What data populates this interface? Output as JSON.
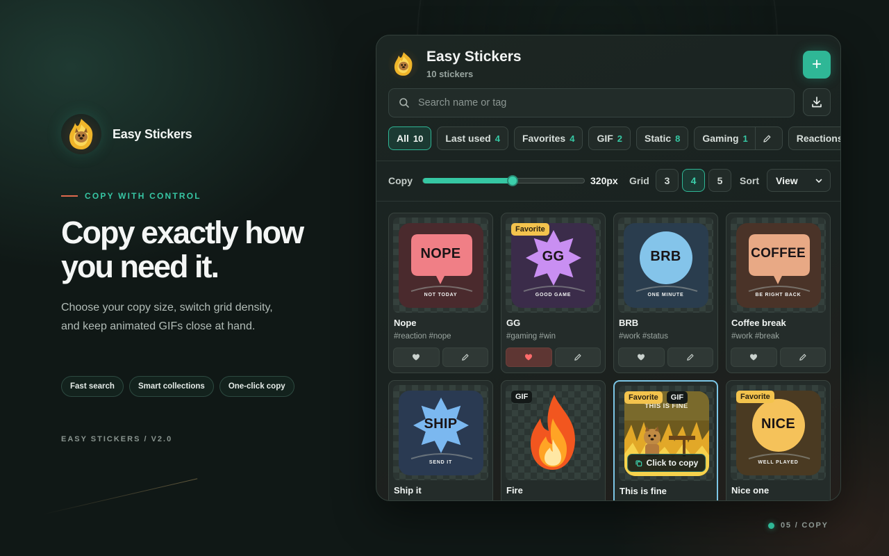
{
  "brand": {
    "name": "Easy Stickers"
  },
  "hero": {
    "eyebrow": "COPY WITH CONTROL",
    "title_line1": "Copy exactly how",
    "title_line2": "you need it.",
    "description": "Choose your copy size, switch grid density, and keep animated GIFs close at hand.",
    "pills": [
      "Fast search",
      "Smart collections",
      "One-click copy"
    ],
    "version": "EASY STICKERS / V2.0"
  },
  "app": {
    "title": "Easy Stickers",
    "count": "10 stickers",
    "search_placeholder": "Search name or tag",
    "filters": [
      {
        "label": "All",
        "count": "10"
      },
      {
        "label": "Last used",
        "count": "4"
      },
      {
        "label": "Favorites",
        "count": "4"
      },
      {
        "label": "GIF",
        "count": "2"
      },
      {
        "label": "Static",
        "count": "8"
      },
      {
        "label": "Gaming",
        "count": "1"
      },
      {
        "label": "Reactions"
      }
    ],
    "controls": {
      "copy_label": "Copy",
      "copy_value": "320px",
      "copy_fraction": 0.55,
      "grid_label": "Grid",
      "grid_options": [
        "3",
        "4",
        "5"
      ],
      "grid_selected": "4",
      "sort_label": "Sort",
      "sort_value": "View"
    },
    "stickers": [
      {
        "name": "Nope",
        "tags": "#reaction #nope",
        "text": "NOPE",
        "sub": "NOT TODAY",
        "color": "#f07f86",
        "bg": "#4a2a2d",
        "shape": "bubble",
        "favorite": false
      },
      {
        "name": "GG",
        "tags": "#gaming #win",
        "text": "GG",
        "sub": "GOOD GAME",
        "color": "#c98ff2",
        "bg": "#3b2c4a",
        "shape": "star",
        "favorite": true,
        "badges": [
          "Favorite"
        ]
      },
      {
        "name": "BRB",
        "tags": "#work #status",
        "text": "BRB",
        "sub": "ONE MINUTE",
        "color": "#84c4ea",
        "bg": "#2a3d4e",
        "shape": "circle",
        "favorite": false
      },
      {
        "name": "Coffee break",
        "tags": "#work #break",
        "text": "COFFEE",
        "sub": "BE RIGHT BACK",
        "color": "#e8a985",
        "bg": "#4a3328",
        "shape": "bubble",
        "favorite": false
      },
      {
        "name": "Ship it",
        "tags": "",
        "text": "SHIP",
        "sub": "SEND IT",
        "color": "#7bb8f0",
        "bg": "#2a3a52",
        "shape": "star",
        "favorite": false
      },
      {
        "name": "Fire",
        "tags": "",
        "text": "",
        "sub": "",
        "color": "#ff8a2a",
        "bg": "",
        "shape": "flame",
        "favorite": false,
        "badges": [
          "GIF"
        ]
      },
      {
        "name": "This is fine",
        "tags": "",
        "text": "THIS IS FINE",
        "sub": "",
        "color": "#d8b64a",
        "bg": "#6e5a1e",
        "shape": "meme",
        "favorite": false,
        "badges": [
          "Favorite",
          "GIF"
        ],
        "overlay": "Click to copy"
      },
      {
        "name": "Nice one",
        "tags": "",
        "text": "NICE",
        "sub": "WELL PLAYED",
        "color": "#f5c25a",
        "bg": "#4a3a22",
        "shape": "circle",
        "favorite": false,
        "badges": [
          "Favorite"
        ]
      }
    ]
  },
  "page_indicator": "05 / COPY"
}
